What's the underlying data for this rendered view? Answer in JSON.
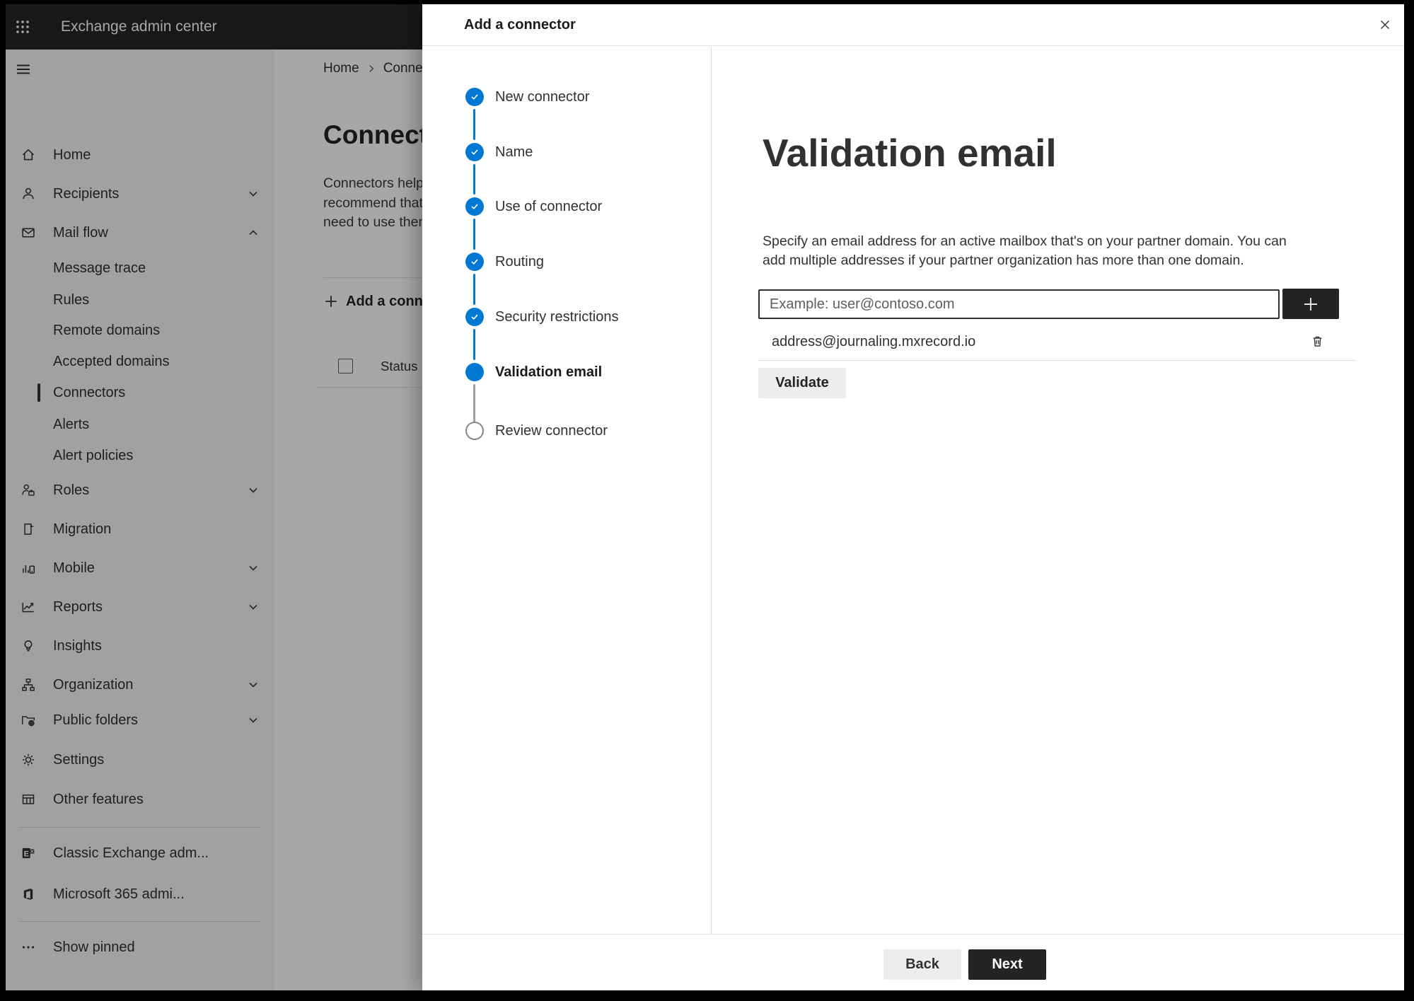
{
  "app": {
    "title": "Exchange admin center"
  },
  "sidebar": {
    "items": [
      {
        "label": "Home"
      },
      {
        "label": "Recipients"
      },
      {
        "label": "Mail flow"
      },
      {
        "label": "Message trace"
      },
      {
        "label": "Rules"
      },
      {
        "label": "Remote domains"
      },
      {
        "label": "Accepted domains"
      },
      {
        "label": "Connectors"
      },
      {
        "label": "Alerts"
      },
      {
        "label": "Alert policies"
      },
      {
        "label": "Roles"
      },
      {
        "label": "Migration"
      },
      {
        "label": "Mobile"
      },
      {
        "label": "Reports"
      },
      {
        "label": "Insights"
      },
      {
        "label": "Organization"
      },
      {
        "label": "Public folders"
      },
      {
        "label": "Settings"
      },
      {
        "label": "Other features"
      },
      {
        "label": "Classic Exchange adm..."
      },
      {
        "label": "Microsoft 365 admi..."
      },
      {
        "label": "Show pinned"
      }
    ]
  },
  "page": {
    "breadcrumb": {
      "home": "Home",
      "current": "Connectors"
    },
    "title": "Connectors",
    "intro_lines": [
      "Connectors help",
      "recommend that",
      "need to use them"
    ],
    "add_button": "Add a connector",
    "columns": {
      "status": "Status"
    }
  },
  "dialog": {
    "title": "Add a connector",
    "steps": [
      {
        "label": "New connector",
        "state": "completed"
      },
      {
        "label": "Name",
        "state": "completed"
      },
      {
        "label": "Use of connector",
        "state": "completed"
      },
      {
        "label": "Routing",
        "state": "completed"
      },
      {
        "label": "Security restrictions",
        "state": "completed"
      },
      {
        "label": "Validation email",
        "state": "current"
      },
      {
        "label": "Review connector",
        "state": "upcoming"
      }
    ],
    "content": {
      "title": "Validation email",
      "description": "Specify an email address for an active mailbox that's on your partner domain. You can add multiple addresses if your partner organization has more than one domain.",
      "email_placeholder": "Example: user@contoso.com",
      "email_value": "",
      "addresses": [
        "address@journaling.mxrecord.io"
      ],
      "validate_label": "Validate"
    },
    "footer": {
      "back_label": "Back",
      "next_label": "Next"
    }
  },
  "colors": {
    "accent": "#0078d4",
    "dark_button": "#252423"
  }
}
